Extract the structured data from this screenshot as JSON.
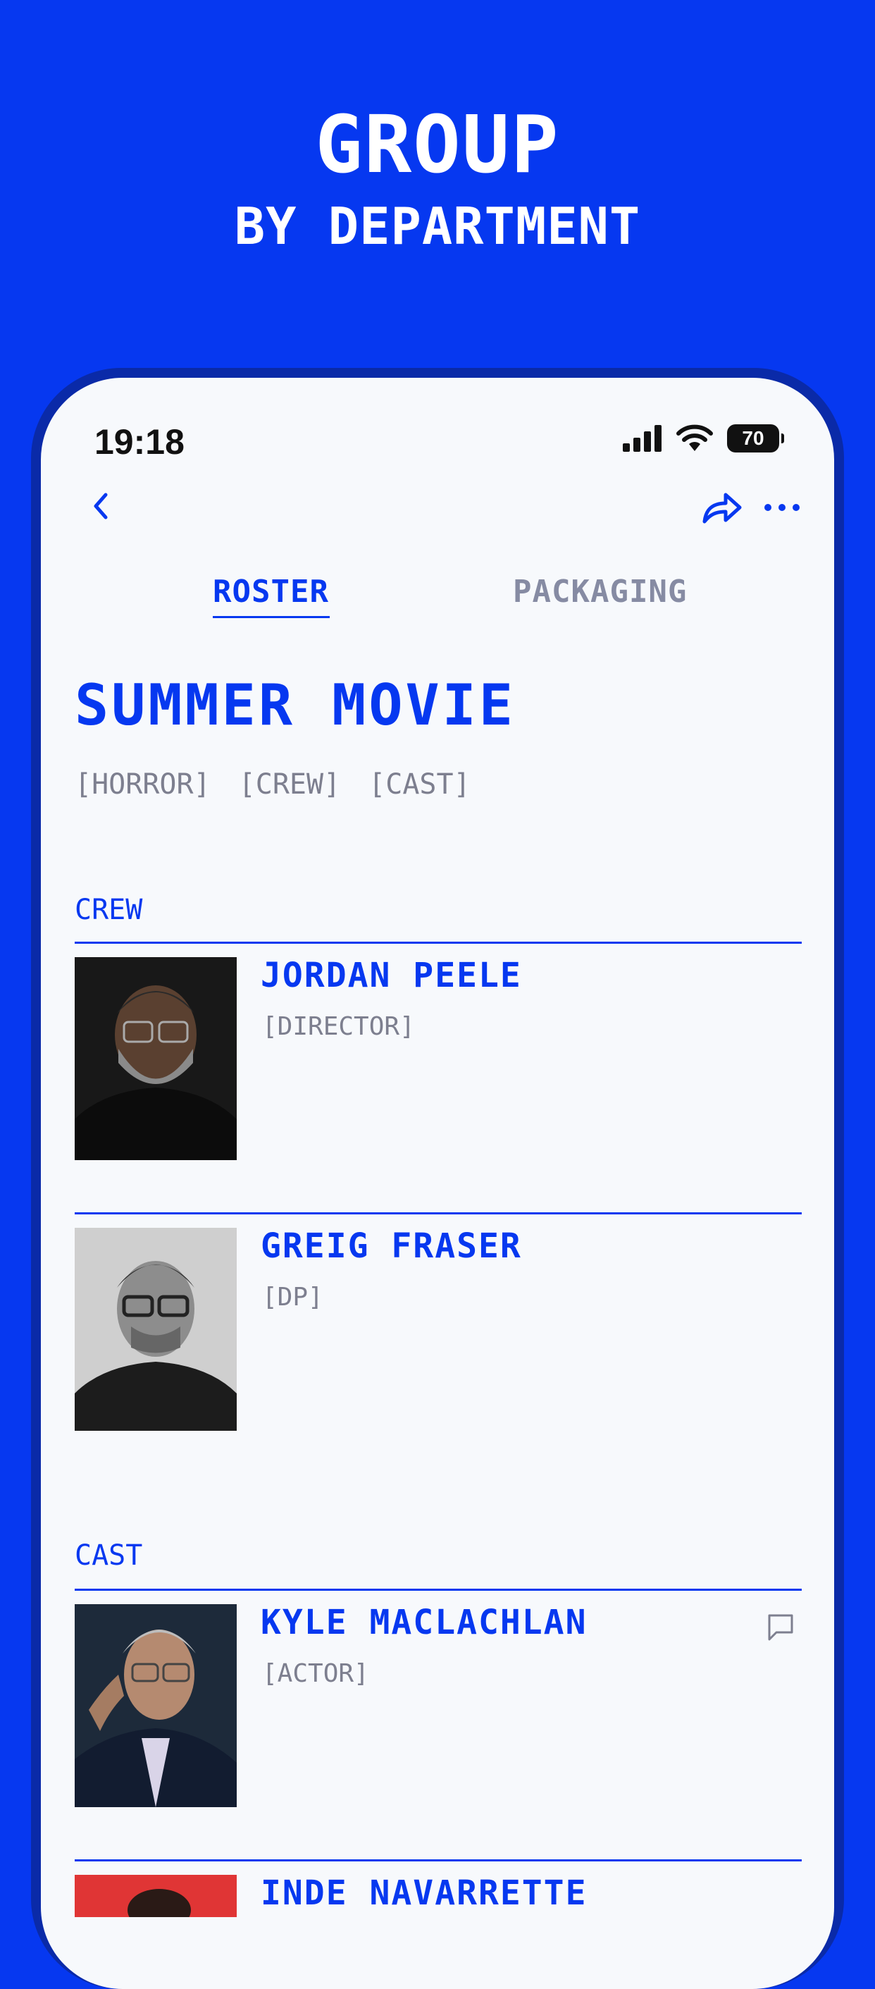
{
  "hero": {
    "title": "GROUP",
    "subtitle": "BY DEPARTMENT"
  },
  "status_bar": {
    "time": "19:18",
    "battery": "70"
  },
  "nav": {
    "back_icon": "chevron-left-icon",
    "share_icon": "share-icon",
    "more_icon": "more-icon"
  },
  "tabs": [
    {
      "label": "ROSTER",
      "active": true
    },
    {
      "label": "PACKAGING",
      "active": false
    }
  ],
  "project": {
    "title": "SUMMER MOVIE",
    "tags": [
      "[HORROR]",
      "[CREW]",
      "[CAST]"
    ]
  },
  "sections": {
    "crew": {
      "label": "CREW",
      "people": [
        {
          "name": "JORDAN PEELE",
          "role": "[DIRECTOR]"
        },
        {
          "name": "GREIG FRASER",
          "role": "[DP]"
        }
      ]
    },
    "cast": {
      "label": "CAST",
      "people": [
        {
          "name": "KYLE MACLACHLAN",
          "role": "[ACTOR]"
        },
        {
          "name": "INDE NAVARRETTE",
          "role": ""
        }
      ]
    }
  },
  "colors": {
    "accent": "#0638F0",
    "background": "#F7F9FC",
    "muted": "#7D7F8F"
  }
}
